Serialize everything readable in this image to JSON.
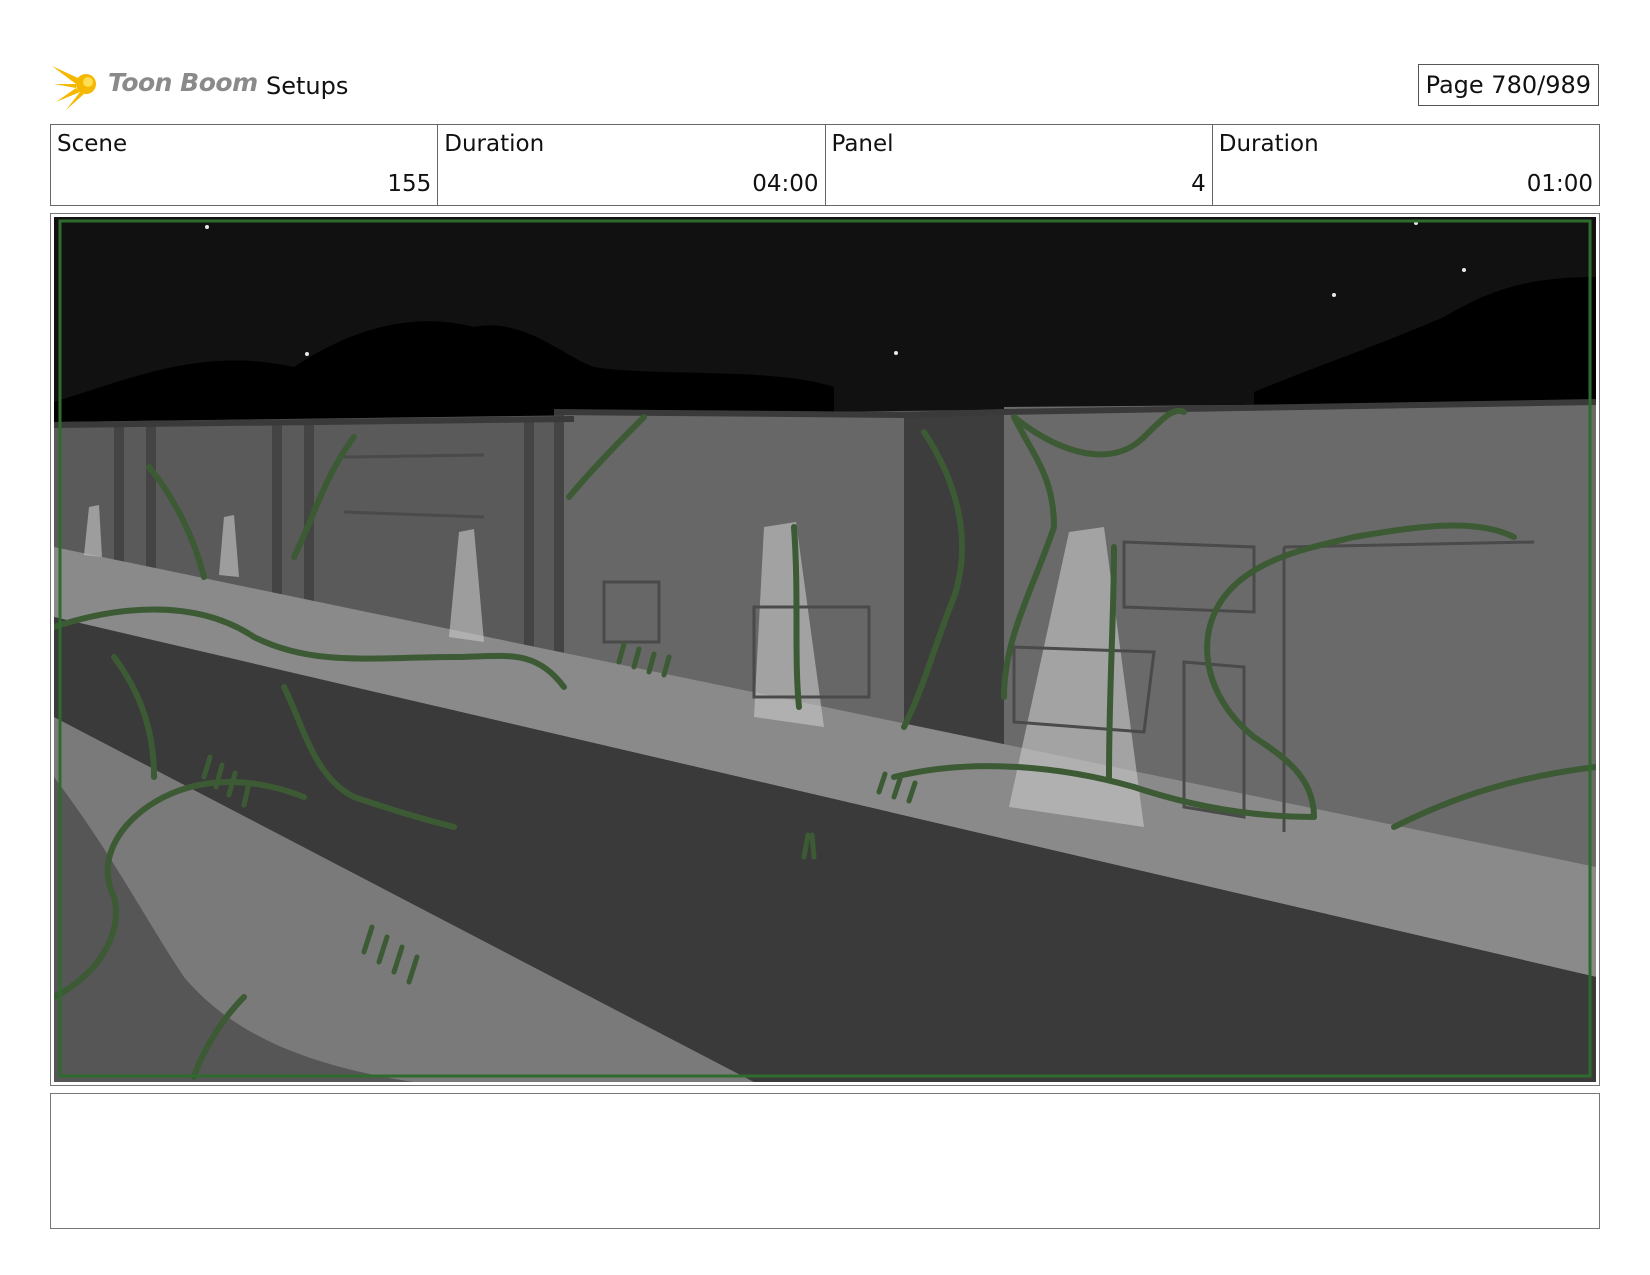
{
  "header": {
    "logo_text": "Toon Boom",
    "section": "Setups",
    "page": "Page 780/989"
  },
  "info": {
    "scene_label": "Scene",
    "scene_value": "155",
    "scene_duration_label": "Duration",
    "scene_duration_value": "04:00",
    "panel_label": "Panel",
    "panel_value": "4",
    "panel_duration_label": "Duration",
    "panel_duration_value": "01:00"
  },
  "notes": {
    "text": ""
  },
  "colors": {
    "safe_frame": "#2f6b2f",
    "vines": "#3c5a34"
  }
}
